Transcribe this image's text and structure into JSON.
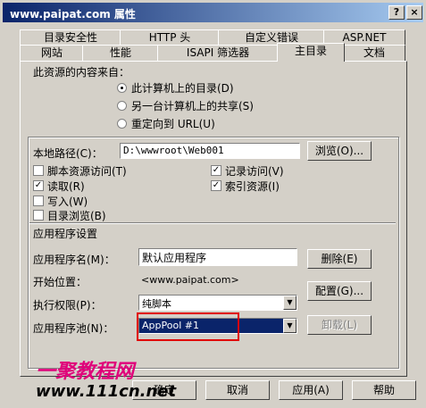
{
  "window": {
    "title": "www.paipat.com 属性"
  },
  "tabs_back": [
    "目录安全性",
    "HTTP 头",
    "自定义错误",
    "ASP.NET"
  ],
  "tabs_front": [
    "网站",
    "性能",
    "ISAPI 筛选器",
    "主目录",
    "文档"
  ],
  "content_source": {
    "heading": "此资源的内容来自：",
    "options": [
      "此计算机上的目录(D)",
      "另一台计算机上的共享(S)",
      "重定向到 URL(U)"
    ]
  },
  "local_path": {
    "label": "本地路径(C)：",
    "value": "D:\\wwwroot\\Web001",
    "browse": "浏览(O)..."
  },
  "permissions": {
    "script_source": "脚本资源访问(T)",
    "read": "读取(R)",
    "write": "写入(W)",
    "dir_browse": "目录浏览(B)",
    "log_visits": "记录访问(V)",
    "index": "索引资源(I)"
  },
  "app_settings": {
    "heading": "应用程序设置",
    "app_name_label": "应用程序名(M)：",
    "app_name_value": "默认应用程序",
    "start_label": "开始位置：",
    "start_value": "<www.paipat.com>",
    "exec_label": "执行权限(P)：",
    "exec_value": "纯脚本",
    "pool_label": "应用程序池(N)：",
    "pool_value": "AppPool #1",
    "remove": "删除(E)",
    "config": "配置(G)...",
    "unload": "卸载(L)"
  },
  "footer": {
    "ok": "确定",
    "cancel": "取消",
    "apply": "应用(A)",
    "help": "帮助"
  },
  "watermark": {
    "line1": "一聚教程网",
    "line2": "www.111cn.net"
  }
}
